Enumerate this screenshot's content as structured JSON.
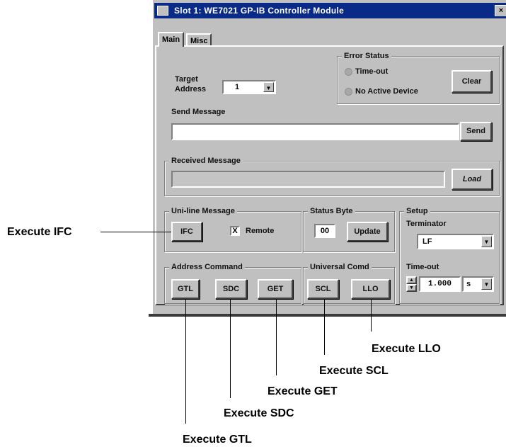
{
  "window": {
    "title": "Slot 1: WE7021 GP-IB Controller Module",
    "close_glyph": "×"
  },
  "tabs": [
    {
      "label": "Main"
    },
    {
      "label": "Misc"
    }
  ],
  "error_status": {
    "legend": "Error Status",
    "timeout_label": "Time-out",
    "no_active_label": "No Active Device",
    "clear_button": "Clear"
  },
  "target_address": {
    "label_line1": "Target",
    "label_line2": "Address",
    "value": "1"
  },
  "send_message": {
    "label": "Send Message",
    "value": "",
    "send_button": "Send"
  },
  "received_message": {
    "legend": "Received Message",
    "value": "",
    "load_button": "Load"
  },
  "uniline": {
    "legend": "Uni-line Message",
    "ifc_button": "IFC",
    "remote_label": "Remote",
    "remote_checked": true
  },
  "status_byte": {
    "legend": "Status Byte",
    "value": "00",
    "update_button": "Update"
  },
  "setup": {
    "legend": "Setup",
    "terminator_label": "Terminator",
    "terminator_value": "LF",
    "timeout_label": "Time-out",
    "timeout_value": "1.000",
    "timeout_unit": "s"
  },
  "address_command": {
    "legend": "Address Command",
    "buttons": [
      "GTL",
      "SDC",
      "GET"
    ]
  },
  "universal_command": {
    "legend": "Universal Comd",
    "buttons": [
      "SCL",
      "LLO"
    ]
  },
  "callouts": {
    "ifc": "Execute IFC",
    "llo": "Execute LLO",
    "scl": "Execute SCL",
    "get": "Execute GET",
    "sdc": "Execute SDC",
    "gtl": "Execute GTL"
  },
  "colors": {
    "titlebar": "#0a2a88",
    "window_face": "#c0c0c0"
  },
  "icons": {
    "combo_arrow": "triangle-down",
    "checkbox_mark": "X"
  }
}
